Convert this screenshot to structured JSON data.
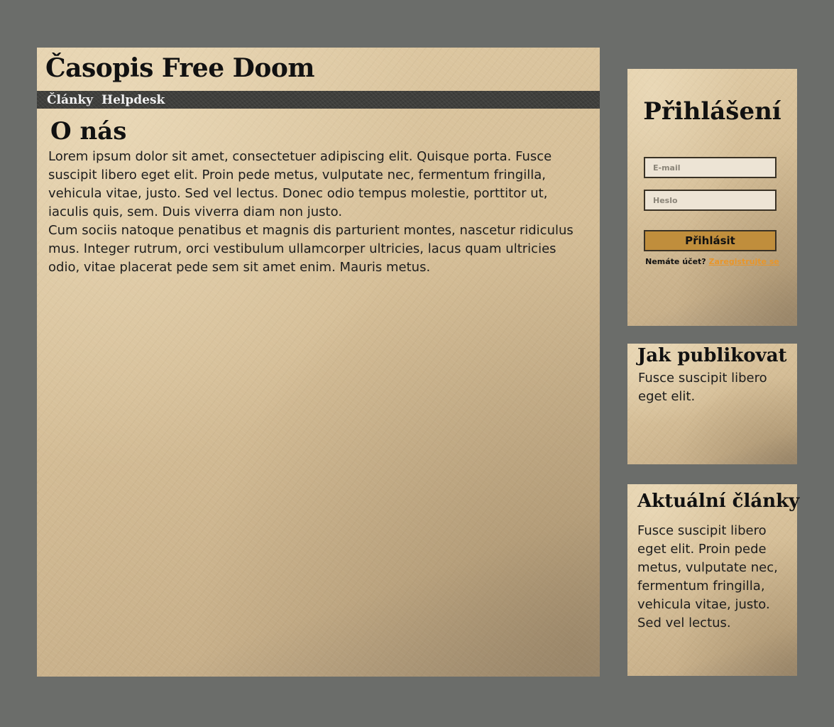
{
  "header": {
    "site_title": "Časopis Free Doom"
  },
  "nav": {
    "items": [
      {
        "label": "Články"
      },
      {
        "label": "Helpdesk"
      }
    ]
  },
  "main": {
    "heading": "O nás",
    "paragraphs": [
      "Lorem ipsum dolor sit amet, consectetuer adipiscing elit. Quisque porta. Fusce suscipit libero eget elit. Proin pede metus, vulputate nec, fermentum fringilla, vehicula vitae, justo. Sed vel lectus. Donec odio tempus molestie, porttitor ut, iaculis quis, sem. Duis viverra diam non justo.",
      "Cum sociis natoque penatibus et magnis dis parturient montes, nascetur ridiculus mus. Integer rutrum, orci vestibulum ullamcorper ultricies, lacus quam ultricies odio, vitae placerat pede sem sit amet enim. Mauris metus."
    ]
  },
  "login": {
    "title": "Přihlášení",
    "email_placeholder": "E-mail",
    "password_placeholder": "Heslo",
    "submit_label": "Přihlásit",
    "no_account_text": "Nemáte účet?",
    "register_link": "Zaregistrujte se"
  },
  "publish": {
    "heading": "Jak publikovat",
    "text": "Fusce suscipit libero eget elit."
  },
  "articles": {
    "heading": "Aktuální články",
    "text": "Fusce suscipit libero eget elit. Proin pede metus, vulputate nec, fermentum fringilla, vehicula vitae, justo. Sed vel lectus."
  },
  "colors": {
    "page_background": "#6b6d6a",
    "paper": "#d6c09a",
    "nav_background": "#3f3f3c",
    "button": "#c08e3c",
    "link": "#e8962a"
  }
}
